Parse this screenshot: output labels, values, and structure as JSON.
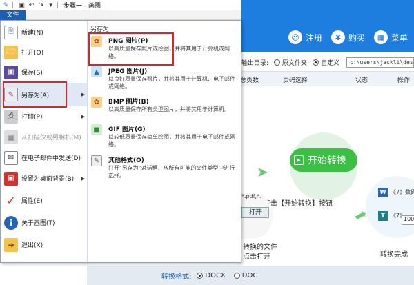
{
  "paint": {
    "title": "步骤一 - 画图",
    "file_tab": "文件",
    "submenu_title": "另存为",
    "left_menu": [
      {
        "label": "新建(N)",
        "icon": "new-document-icon",
        "disabled": false,
        "arrow": false
      },
      {
        "label": "打开(O)",
        "icon": "open-folder-icon",
        "disabled": false,
        "arrow": false
      },
      {
        "label": "保存(S)",
        "icon": "save-disk-icon",
        "disabled": false,
        "arrow": false
      },
      {
        "label": "另存为(A)",
        "icon": "save-as-icon",
        "disabled": false,
        "arrow": true
      },
      {
        "label": "打印(P)",
        "icon": "printer-icon",
        "disabled": false,
        "arrow": true
      },
      {
        "label": "从扫描仪或照相机(M)",
        "icon": "scanner-icon",
        "disabled": true,
        "arrow": false
      },
      {
        "label": "在电子邮件中发送(D)",
        "icon": "email-icon",
        "disabled": false,
        "arrow": false
      },
      {
        "label": "设置为桌面背景(B)",
        "icon": "desktop-background-icon",
        "disabled": false,
        "arrow": true
      },
      {
        "label": "属性(E)",
        "icon": "checkmark-icon",
        "disabled": false,
        "arrow": false
      },
      {
        "label": "关于画图(T)",
        "icon": "info-icon",
        "disabled": false,
        "arrow": false
      },
      {
        "label": "退出(X)",
        "icon": "exit-icon",
        "disabled": false,
        "arrow": false
      }
    ],
    "save_as_options": [
      {
        "name": "PNG 图片(P)",
        "desc": "以高质量保存照片或绘图，并将其用于计算机或网络。",
        "icon": "png-image-icon"
      },
      {
        "name": "JPEG 图片(J)",
        "desc": "以良好质量保存照片，并将其用于计算机、电子邮件或网络。",
        "icon": "jpeg-image-icon"
      },
      {
        "name": "BMP 图片(B)",
        "desc": "以高质量保存所有类型图片，并将其用于计算机。",
        "icon": "bmp-image-icon"
      },
      {
        "name": "GIF 图片(G)",
        "desc": "以较低质量保存简单绘图，并将其用于电子邮件或网络。",
        "icon": "gif-image-icon"
      },
      {
        "name": "其他格式(O)",
        "desc": "打开\"另存为\"对话框，从所有可能的文件类型中进行选择。",
        "icon": "other-formats-icon"
      }
    ]
  },
  "converter": {
    "register": "注册",
    "buy": "购买",
    "menu": "菜单",
    "output_dir_label": "输出目录:",
    "original_folder": "原文件夹",
    "custom": "自定义",
    "output_path": "c:\\users\\jackli\\des",
    "columns": [
      "总页数",
      "页码选择",
      "状态",
      "操作"
    ],
    "start_button": "开始转换",
    "click_instruction": "点击【开始转换】按钮",
    "open_button": "打开",
    "pdf_fragment": "*.pdf,*.",
    "add_file_line1": "转换的文件",
    "add_file_line2": "点击打开",
    "done_text": "转换完成",
    "word_fragment": "《7》数码",
    "pub_fragment": "《7》",
    "zoom_fragment": "100",
    "format_label": "转换格式:",
    "format_docx": "DOCX",
    "format_doc": "DOC"
  }
}
